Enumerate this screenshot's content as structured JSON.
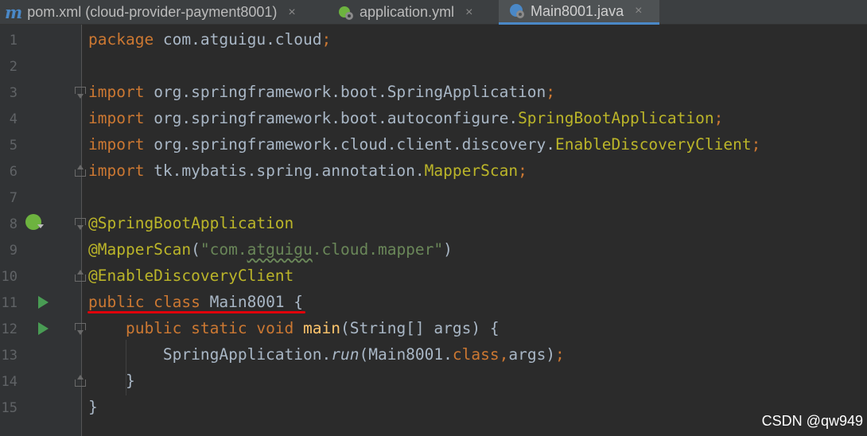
{
  "tabs": [
    {
      "icon": "maven-icon",
      "label": "pom.xml (cloud-provider-payment8001)",
      "active": false
    },
    {
      "icon": "spring-config-icon",
      "label": "application.yml",
      "active": false
    },
    {
      "icon": "spring-class-icon",
      "label": "Main8001.java",
      "active": true
    }
  ],
  "tab_icon_glyph": "m",
  "close_glyph": "×",
  "line_numbers": [
    "1",
    "2",
    "3",
    "4",
    "5",
    "6",
    "7",
    "8",
    "9",
    "10",
    "11",
    "12",
    "13",
    "14",
    "15"
  ],
  "code": {
    "l1": {
      "kw": "package",
      "pkg": " com.atguigu.cloud",
      "semi": ";"
    },
    "l3": {
      "kw": "import",
      "pkg": " org.springframework.boot.SpringApplication",
      "semi": ";"
    },
    "l4": {
      "kw": "import",
      "pkg": " org.springframework.boot.autoconfigure.",
      "cls": "SpringBootApplication",
      "semi": ";"
    },
    "l5": {
      "kw": "import",
      "pkg": " org.springframework.cloud.client.discovery.",
      "cls": "EnableDiscoveryClient",
      "semi": ";"
    },
    "l6": {
      "kw": "import",
      "pkg": " tk.mybatis.spring.annotation.",
      "cls": "MapperScan",
      "semi": ";"
    },
    "l8": {
      "ann": "@SpringBootApplication"
    },
    "l9": {
      "ann": "@MapperScan",
      "p1": "(",
      "str1": "\"com.",
      "str_sq": "atguigu",
      "str2": ".cloud.mapper\"",
      "p2": ")"
    },
    "l10": {
      "ann": "@EnableDiscoveryClient"
    },
    "l11": {
      "kw": "public class",
      "rest": " Main8001 {"
    },
    "l12": {
      "indent": "    ",
      "kw": "public static void",
      "fn": " main",
      "rest": "(String[] args) {"
    },
    "l13": {
      "indent": "        ",
      "cls": "SpringApplication.",
      "it": "run",
      "rest1": "(Main8001.",
      "kw": "class",
      "comma": ",",
      "rest2": "args)",
      "semi": ";"
    },
    "l14": {
      "text": "    }"
    },
    "l15": {
      "text": "}"
    }
  },
  "watermark": "CSDN @qw949",
  "colors": {
    "keyword": "#cc7832",
    "annotation": "#bbb529",
    "string": "#6a8759",
    "function": "#ffc66d",
    "text": "#a9b7c6",
    "highlight_underline": "#e0000a"
  }
}
